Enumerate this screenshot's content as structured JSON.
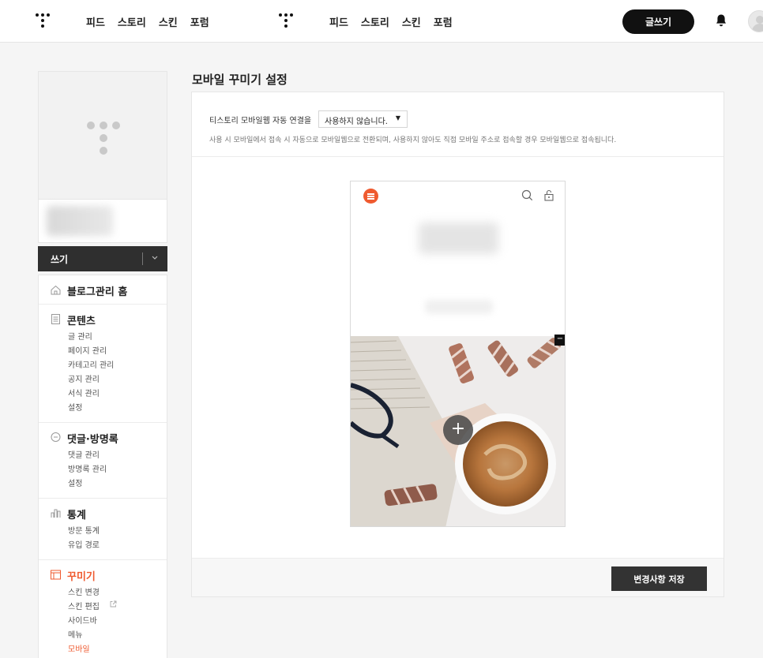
{
  "header": {
    "nav1": [
      "피드",
      "스토리",
      "스킨",
      "포럼"
    ],
    "nav2": [
      "피드",
      "스토리",
      "스킨",
      "포럼"
    ],
    "write_label": "글쓰기"
  },
  "sidebar": {
    "write_label": "쓰기",
    "sections": [
      {
        "title": "블로그관리 홈",
        "icon": "home-icon",
        "items": []
      },
      {
        "title": "콘텐츠",
        "icon": "document-icon",
        "items": [
          "글 관리",
          "페이지 관리",
          "카테고리 관리",
          "공지 관리",
          "서식 관리",
          "설정"
        ]
      },
      {
        "title": "댓글·방명록",
        "icon": "comment-icon",
        "items": [
          "댓글 관리",
          "방명록 관리",
          "설정"
        ]
      },
      {
        "title": "통계",
        "icon": "stats-icon",
        "items": [
          "방문 통계",
          "유입 경로"
        ]
      },
      {
        "title": "꾸미기",
        "icon": "layout-icon",
        "items": [
          "스킨 변경",
          "스킨 편집",
          "사이드바",
          "메뉴",
          "모바일"
        ]
      }
    ]
  },
  "main": {
    "title": "모바일 꾸미기 설정",
    "option_label": "티스토리 모바일웹 자동 연결을",
    "select_value": "사용하지 않습니다.",
    "description": "사용 시 모바일에서 접속 시 자동으로 모바일웹으로 전환되며, 사용하지 않아도 직접 모바일 주소로 접속할 경우 모바일웹으로 접속됩니다.",
    "save_label": "변경사항 저장"
  },
  "colors": {
    "accent": "#ef5a2f",
    "dark": "#2f2f2f"
  }
}
